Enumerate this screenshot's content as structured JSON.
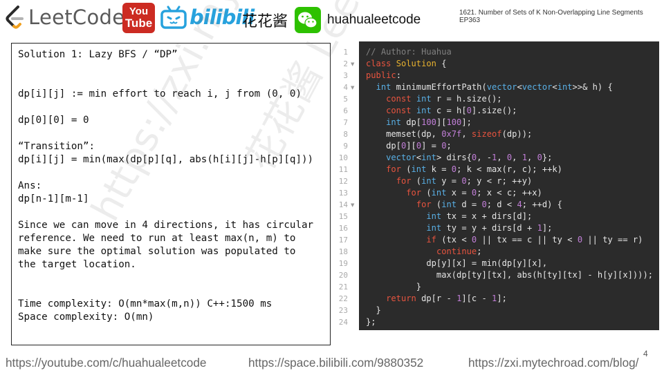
{
  "header": {
    "logo_text": "LeetCode",
    "youtube_top": "You",
    "youtube_bottom": "Tube",
    "bilibili_text": "bilibili",
    "channel_cn": "花花酱",
    "handle": "huahualeetcode",
    "slide_title": "1621. Number of Sets of K Non-Overlapping Line Segments EP363"
  },
  "watermark": {
    "line1": "花花酱 LeetCode",
    "line2": "https://zxi.mytechroad.com"
  },
  "solution": {
    "lines": [
      "Solution 1: Lazy BFS / “DP”",
      "dp[i][j] := min effort to reach i, j from (0, 0)",
      "dp[0][0] = 0",
      "“Transition”:",
      "dp[i][j] = min(max(dp[p][q], abs(h[i][j]-h[p][q]))",
      "Ans:",
      "dp[n-1][m-1]",
      "Since we can move in 4 directions, it has circular",
      "reference. We need to run at least max(n, m) to",
      "make sure the optimal solution was populated to",
      "the target location.",
      "Time complexity: O(mn*max(m,n)) C++:1500 ms",
      "Space complexity: O(mn)"
    ]
  },
  "code": {
    "line_numbers": [
      "1",
      "2",
      "3",
      "4",
      "5",
      "6",
      "7",
      "8",
      "9",
      "10",
      "11",
      "12",
      "13",
      "14",
      "15",
      "16",
      "17",
      "18",
      "19",
      "20",
      "21",
      "22",
      "23",
      "24"
    ],
    "lines": [
      "// Author: Huahua",
      "class Solution {",
      "public:",
      "  int minimumEffortPath(vector<vector<int>>& h) {",
      "    const int r = h.size();",
      "    const int c = h[0].size();",
      "    int dp[100][100];",
      "    memset(dp, 0x7f, sizeof(dp));",
      "    dp[0][0] = 0;",
      "    vector<int> dirs{0, -1, 0, 1, 0};",
      "    for (int k = 0; k < max(r, c); ++k)",
      "      for (int y = 0; y < r; ++y)",
      "        for (int x = 0; x < c; ++x)",
      "          for (int d = 0; d < 4; ++d) {",
      "            int tx = x + dirs[d];",
      "            int ty = y + dirs[d + 1];",
      "            if (tx < 0 || tx == c || ty < 0 || ty == r)",
      "              continue;",
      "            dp[y][x] = min(dp[y][x],",
      "              max(dp[ty][tx], abs(h[ty][tx] - h[y][x])));",
      "          }",
      "    return dp[r - 1][c - 1];",
      "  }",
      "};"
    ]
  },
  "footer": {
    "page_number": "4",
    "youtube_url": "https://youtube.com/c/huahualeetcode",
    "bilibili_url": "https://space.bilibili.com/9880352",
    "blog_url": "https://zxi.mytechroad.com/blog/"
  },
  "colors": {
    "code_bg": "#2b2b2b",
    "keyword": "#e8543f",
    "type": "#59b0e6",
    "class_name": "#e8b22f",
    "number": "#c27fd8",
    "comment": "#808080",
    "youtube_red": "#cc2b22",
    "bilibili_blue": "#27a2dd",
    "wechat_green": "#2dc100"
  }
}
